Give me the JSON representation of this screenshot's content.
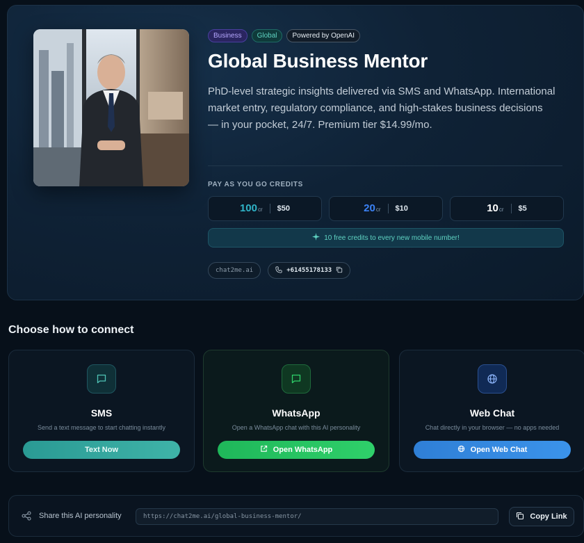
{
  "hero": {
    "tags": [
      "Business",
      "Global",
      "Powered by OpenAI"
    ],
    "title": "Global Business Mentor",
    "description": "PhD-level strategic insights delivered via SMS and WhatsApp. International market entry, regulatory compliance, and high-stakes business decisions — in your pocket, 24/7. Premium tier $14.99/mo.",
    "credits_label": "PAY AS YOU GO CREDITS",
    "credit_packs": [
      {
        "amount": "100",
        "unit": "cr",
        "price": "$50",
        "color": "#2fb4c8"
      },
      {
        "amount": "20",
        "unit": "cr",
        "price": "$10",
        "color": "#3b82f6"
      },
      {
        "amount": "10",
        "unit": "cr",
        "price": "$5",
        "color": "#ffffff"
      }
    ],
    "free_banner": "10 free credits to every new mobile number!",
    "domain_chip": "chat2me.ai",
    "phone_chip": "+61455178133"
  },
  "connect": {
    "title": "Choose how to connect",
    "cards": [
      {
        "title": "SMS",
        "subtitle": "Send a text message to start chatting instantly",
        "cta": "Text Now"
      },
      {
        "title": "WhatsApp",
        "subtitle": "Open a WhatsApp chat with this AI personality",
        "cta": "Open WhatsApp"
      },
      {
        "title": "Web Chat",
        "subtitle": "Chat directly in your browser — no apps needed",
        "cta": "Open Web Chat"
      }
    ]
  },
  "share": {
    "label": "Share this AI personality",
    "url": "https://chat2me.ai/global-business-mentor/",
    "copy_label": "Copy Link"
  },
  "colors": {
    "accent_teal": "#5fd3c2",
    "whatsapp_green": "#25c05f",
    "webchat_blue": "#3b8ee6",
    "business_purple": "#b6a8ff"
  }
}
